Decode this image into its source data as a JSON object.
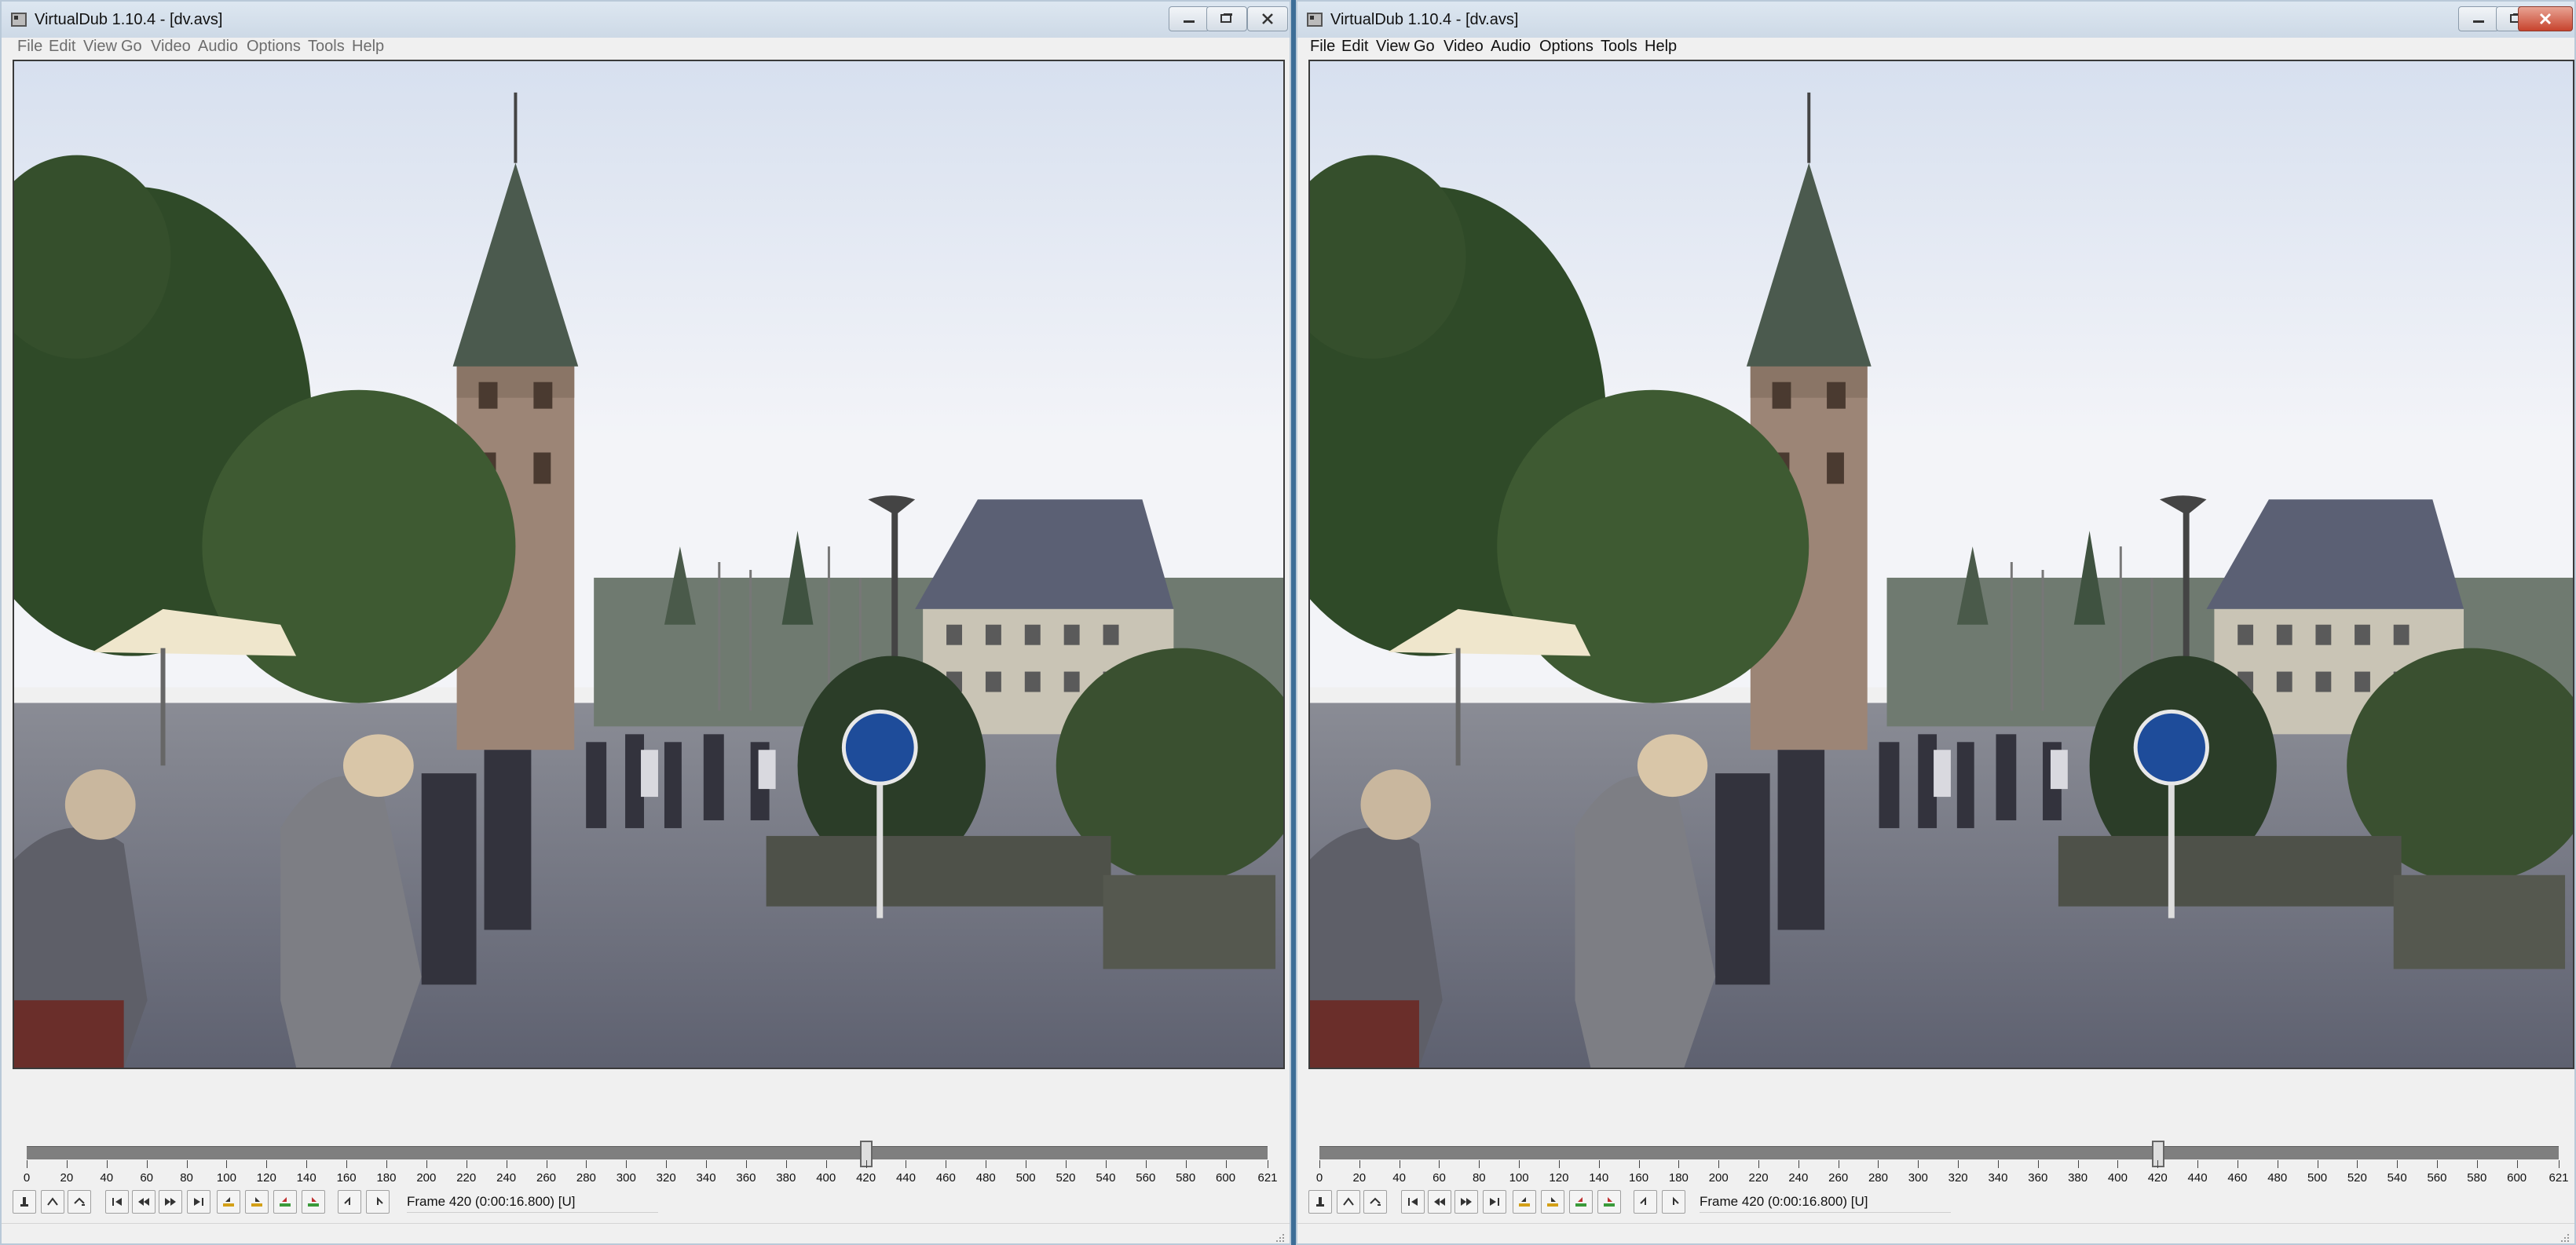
{
  "left_window": {
    "title": "VirtualDub 1.10.4 - [dv.avs]",
    "menu": [
      "File",
      "Edit",
      "View",
      "Go",
      "Video",
      "Audio",
      "Options",
      "Tools",
      "Help"
    ],
    "timeline_labels": [
      "0",
      "20",
      "40",
      "60",
      "80",
      "100",
      "120",
      "140",
      "160",
      "180",
      "200",
      "220",
      "240",
      "260",
      "280",
      "300",
      "320",
      "340",
      "360",
      "380",
      "400",
      "420",
      "440",
      "460",
      "480",
      "500",
      "520",
      "540",
      "560",
      "580",
      "600",
      "621"
    ],
    "current_frame": 420,
    "frame_max": 621,
    "status_text": "Frame 420 (0:00:16.800) [U]"
  },
  "right_window": {
    "title": "VirtualDub 1.10.4 - [dv.avs]",
    "menu": [
      "File",
      "Edit",
      "View",
      "Go",
      "Video",
      "Audio",
      "Options",
      "Tools",
      "Help"
    ],
    "timeline_labels": [
      "0",
      "20",
      "40",
      "60",
      "80",
      "100",
      "120",
      "140",
      "160",
      "180",
      "200",
      "220",
      "240",
      "260",
      "280",
      "300",
      "320",
      "340",
      "360",
      "380",
      "400",
      "420",
      "440",
      "460",
      "480",
      "500",
      "520",
      "540",
      "560",
      "580",
      "600",
      "621"
    ],
    "current_frame": 420,
    "frame_max": 621,
    "status_text": "Frame 420 (0:00:16.800) [U]"
  },
  "toolbar_icons": [
    "stop-icon",
    "play-input-icon",
    "play-output-icon",
    "go-start-icon",
    "step-back-icon",
    "step-forward-icon",
    "go-end-icon",
    "prev-keyframe-icon",
    "next-keyframe-icon",
    "scene-rev-icon",
    "scene-fwd-icon",
    "mark-in-icon",
    "mark-out-icon"
  ],
  "colors": {
    "accent": "#3d6e97",
    "close_red": "#c7432d",
    "track": "#7f7f7f"
  }
}
